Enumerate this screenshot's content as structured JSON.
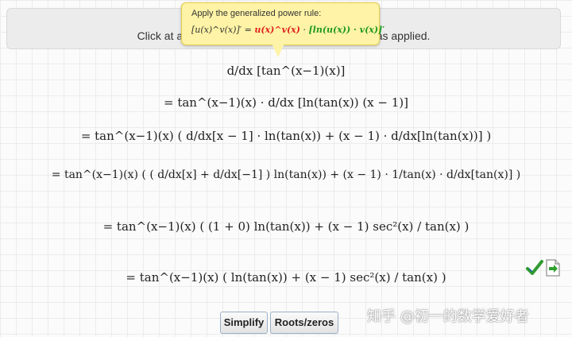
{
  "info_bar": {
    "text": "Click at any derivation step to see the rule that was applied."
  },
  "tooltip": {
    "title": "Apply the generalized power rule:",
    "formula_lhs": "[u(x)^v(x)]′ =",
    "formula_u": "u(x)^v(x)",
    "formula_mid": "·",
    "formula_ln": "[ln(u(x)) · v(x)]′"
  },
  "steps": [
    "d/dx [tan^(x−1)(x)]",
    "= tan^(x−1)(x) · d/dx [ln(tan(x)) (x − 1)]",
    "= tan^(x−1)(x) ( d/dx[x − 1] · ln(tan(x)) + (x − 1) · d/dx[ln(tan(x))] )",
    "= tan^(x−1)(x) ( ( d/dx[x] + d/dx[−1] ) ln(tan(x)) + (x − 1) · 1/tan(x) · d/dx[tan(x)] )",
    "= tan^(x−1)(x) ( (1 + 0) ln(tan(x)) + (x − 1) sec²(x) / tan(x) )",
    "= tan^(x−1)(x) ( ln(tan(x)) + (x − 1) sec²(x) / tan(x) )"
  ],
  "buttons": {
    "simplify": "Simplify",
    "roots": "Roots/zeros"
  },
  "watermark": "知乎 @初一的数学爱好者",
  "icons": {
    "check": "checkmark-icon",
    "export": "export-icon"
  }
}
